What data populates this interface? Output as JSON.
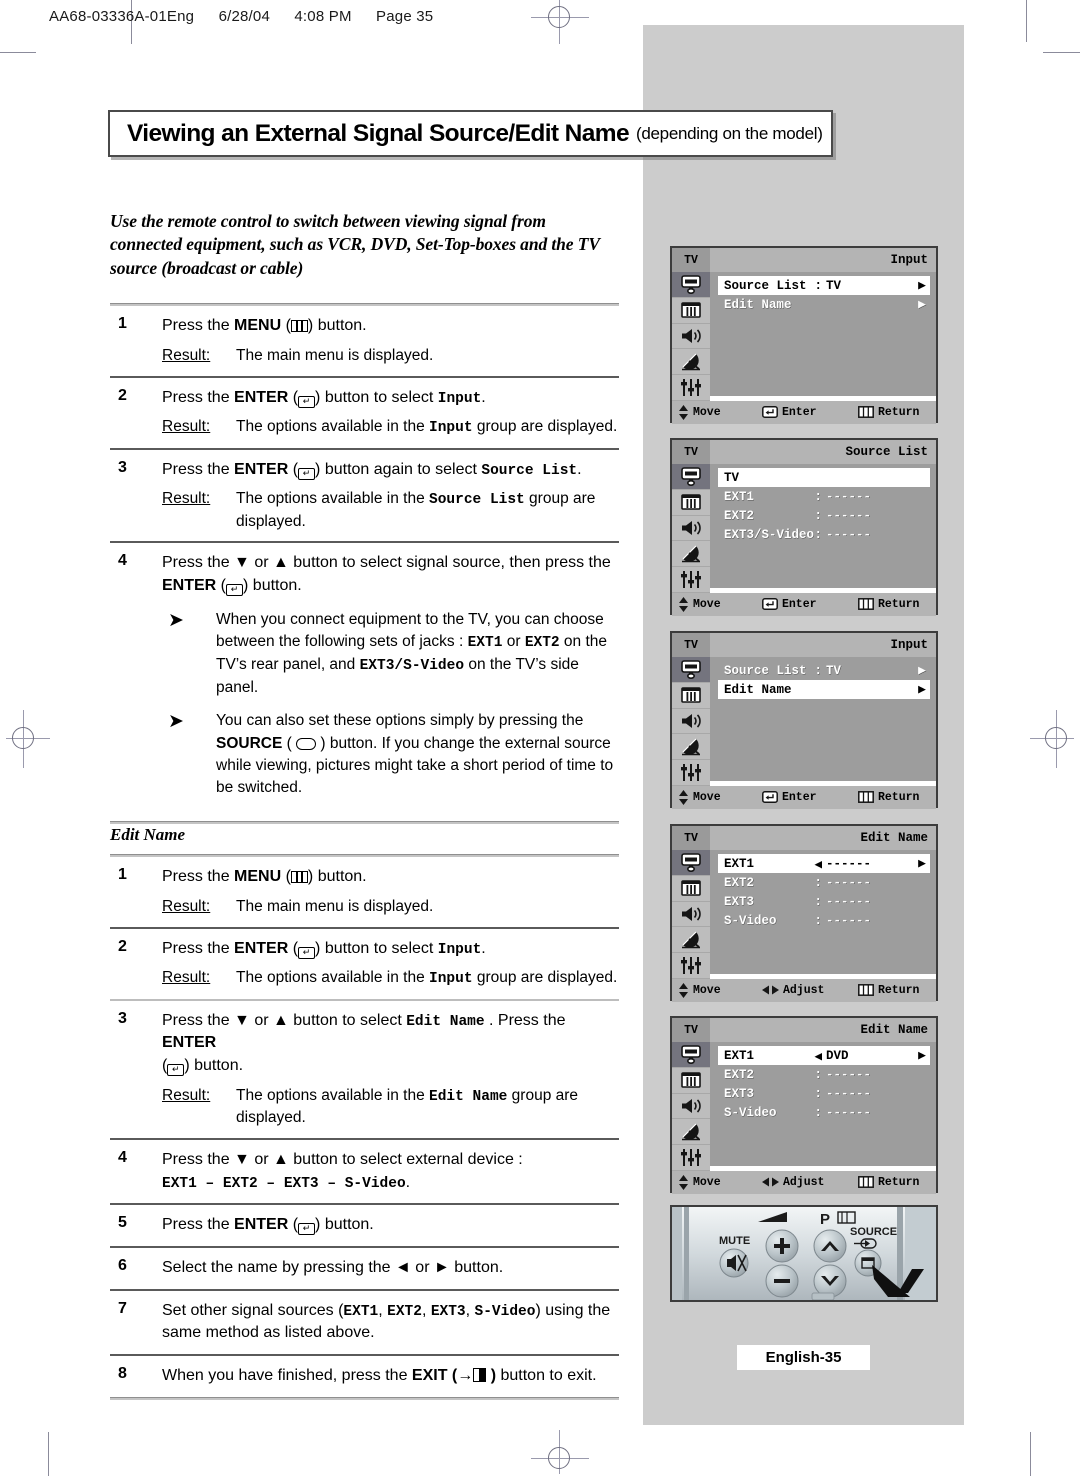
{
  "file_header": [
    "AA68-03336A-01Eng",
    "6/28/04",
    "4:08 PM",
    "Page 35"
  ],
  "title": {
    "main": "Viewing an External Signal Source/Edit Name",
    "suffix": "(depending on the model)"
  },
  "intro": "Use the remote control to switch between viewing signal from connected equipment, such as VCR, DVD, Set-Top-boxes and the TV source (broadcast or cable)",
  "section_a": {
    "steps": [
      {
        "num": "1",
        "text_pre": "Press the ",
        "bold": "MENU",
        "icon": "menu-icon",
        "text_post": " button.",
        "result_label": "Result:",
        "result": "The main menu is displayed."
      },
      {
        "num": "2",
        "text_pre": "Press the ",
        "bold": "ENTER",
        "icon": "enter-icon",
        "text_post": " button to select ",
        "mono": "Input",
        "tail": ".",
        "result_label": "Result:",
        "result_pre": "The options available in the ",
        "result_mono": "Input",
        "result_post": " group are displayed."
      },
      {
        "num": "3",
        "text_pre": "Press the ",
        "bold": "ENTER",
        "icon": "enter-icon",
        "text_post": " button again to select ",
        "mono": "Source List",
        "tail": ".",
        "result_label": "Result:",
        "result_pre": "The options available in the ",
        "result_mono": "Source List",
        "result_post": " group are displayed."
      },
      {
        "num": "4",
        "text_pre": "Press the ▼ or ▲ button to select signal source, then press the ",
        "bold": "ENTER",
        "icon": "enter-icon",
        "text_post": " button."
      }
    ],
    "notes": [
      {
        "p1": "When you connect equipment to the TV, you can choose between the following sets of jacks : ",
        "m1": "EXT1",
        "p2": " or ",
        "m2": "EXT2",
        "p3": " on the TV’s rear panel, and ",
        "m3": "EXT3/S-Video",
        "p4": " on the TV’s side panel."
      },
      {
        "p1": "You can also set these options simply by pressing the ",
        "b1": "SOURCE",
        "icon": "source-icon",
        "p2": " button. If you change the external source while viewing, pictures might take a short period of time to be switched."
      }
    ]
  },
  "section_b": {
    "heading": "Edit Name",
    "steps": [
      {
        "num": "1",
        "text_pre": "Press the ",
        "bold": "MENU",
        "icon": "menu-icon",
        "text_post": " button.",
        "result_label": "Result:",
        "result": "The main menu is displayed."
      },
      {
        "num": "2",
        "text_pre": "Press the ",
        "bold": "ENTER",
        "icon": "enter-icon",
        "text_post": " button to select ",
        "mono": "Input",
        "tail": ".",
        "result_label": "Result:",
        "result_pre": "The options available in the ",
        "result_mono": "Input",
        "result_post": " group are displayed."
      },
      {
        "num": "3",
        "text_pre": "Press the ▼ or ▲ button to select ",
        "mono": "Edit Name",
        "text_mid": " . Press the ",
        "bold": "ENTER",
        "icon": "enter-icon",
        "text_post": " button.",
        "result_label": "Result:",
        "result_pre": "The options available in the ",
        "result_mono": "Edit Name",
        "result_post": " group are displayed."
      },
      {
        "num": "4",
        "text_pre": "Press the ▼ or ▲ button to select external device :",
        "mono_line": "EXT1 – EXT2 – EXT3 – S-Video",
        "tail": "."
      },
      {
        "num": "5",
        "text_pre": "Press the ",
        "bold": "ENTER",
        "icon": "enter-icon",
        "text_post": "  button."
      },
      {
        "num": "6",
        "text_pre": "Select the name by pressing the ◄ or ► button."
      },
      {
        "num": "7",
        "text_pre": "Set other signal sources (",
        "m1": "EXT1",
        "p2": ", ",
        "m2": "EXT2",
        "p3": ", ",
        "m3": "EXT3",
        "p4": ", ",
        "m4": "S-Video",
        "p5": ") using the same method as listed above."
      },
      {
        "num": "8",
        "text_pre": "When you have finished, press the ",
        "bold": "EXIT",
        "icon": "exit-icon",
        "text_post": " button to exit."
      }
    ]
  },
  "osd_common": {
    "tv_tag": "TV",
    "sidebar_icons": [
      "input-source-icon",
      "picture-icon",
      "sound-icon",
      "channel-dish-icon",
      "setup-sliders-icon"
    ],
    "footer_move": "Move",
    "footer_enter": "Enter",
    "footer_adjust": "Adjust",
    "footer_return": "Return"
  },
  "osd_screens": [
    {
      "id": "input-menu-source-list-selected",
      "title": "Input",
      "footer": [
        "Move",
        "Enter",
        "Return"
      ],
      "footer_mid_icon": "enter-icon",
      "rows": [
        {
          "label": "Source List",
          "sep": ":",
          "value": "TV",
          "arrow_right": "▶",
          "selected": true
        },
        {
          "label": "Edit Name",
          "sep": "",
          "value": "",
          "arrow_right": "▶",
          "selected": false
        }
      ]
    },
    {
      "id": "source-list-menu",
      "title": "Source List",
      "footer": [
        "Move",
        "Enter",
        "Return"
      ],
      "footer_mid_icon": "enter-icon",
      "rows": [
        {
          "label": "TV",
          "sep": "",
          "value": "",
          "arrow_right": "",
          "selected": true
        },
        {
          "label": "EXT1",
          "sep": ":",
          "value": "------",
          "arrow_right": "",
          "selected": false
        },
        {
          "label": "EXT2",
          "sep": ":",
          "value": "------",
          "arrow_right": "",
          "selected": false
        },
        {
          "label": "EXT3/S-Video",
          "sep": ":",
          "value": "------",
          "arrow_right": "",
          "selected": false
        }
      ]
    },
    {
      "id": "input-menu-edit-name-selected",
      "title": "Input",
      "footer": [
        "Move",
        "Enter",
        "Return"
      ],
      "footer_mid_icon": "enter-icon",
      "rows": [
        {
          "label": "Source List",
          "sep": ":",
          "value": "TV",
          "arrow_right": "▶",
          "selected": false
        },
        {
          "label": "Edit Name",
          "sep": "",
          "value": "",
          "arrow_right": "▶",
          "selected": true
        }
      ]
    },
    {
      "id": "edit-name-menu-blank",
      "title": "Edit Name",
      "footer": [
        "Move",
        "Adjust",
        "Return"
      ],
      "footer_mid_icon": "left-right-arrows-icon",
      "rows": [
        {
          "label": "EXT1",
          "sep": "◀",
          "value": "------",
          "arrow_right": "▶",
          "selected": true
        },
        {
          "label": "EXT2",
          "sep": ":",
          "value": "------",
          "arrow_right": "",
          "selected": false
        },
        {
          "label": "EXT3",
          "sep": ":",
          "value": "------",
          "arrow_right": "",
          "selected": false
        },
        {
          "label": "S-Video",
          "sep": ":",
          "value": "------",
          "arrow_right": "",
          "selected": false
        }
      ]
    },
    {
      "id": "edit-name-menu-dvd",
      "title": "Edit Name",
      "footer": [
        "Move",
        "Adjust",
        "Return"
      ],
      "footer_mid_icon": "left-right-arrows-icon",
      "rows": [
        {
          "label": "EXT1",
          "sep": "◀",
          "value": "DVD",
          "arrow_right": "▶",
          "selected": true
        },
        {
          "label": "EXT2",
          "sep": ":",
          "value": "------",
          "arrow_right": "",
          "selected": false
        },
        {
          "label": "EXT3",
          "sep": ":",
          "value": "------",
          "arrow_right": "",
          "selected": false
        },
        {
          "label": "S-Video",
          "sep": ":",
          "value": "------",
          "arrow_right": "",
          "selected": false
        }
      ]
    }
  ],
  "tv_panel": {
    "mute_label": "MUTE",
    "program_label": "P",
    "source_label": "SOURCE",
    "volume_up": "+",
    "volume_down": "–",
    "channel_up": "⌃",
    "channel_down": "⌄"
  },
  "page_footer": "English-35",
  "colors": {
    "gray_panel": "#cccccc",
    "osd_bg": "#9d9d9d",
    "osd_bar": "#b4b4b4",
    "osd_selected": "#ffffff",
    "sidebar_selected": "#74747e"
  }
}
